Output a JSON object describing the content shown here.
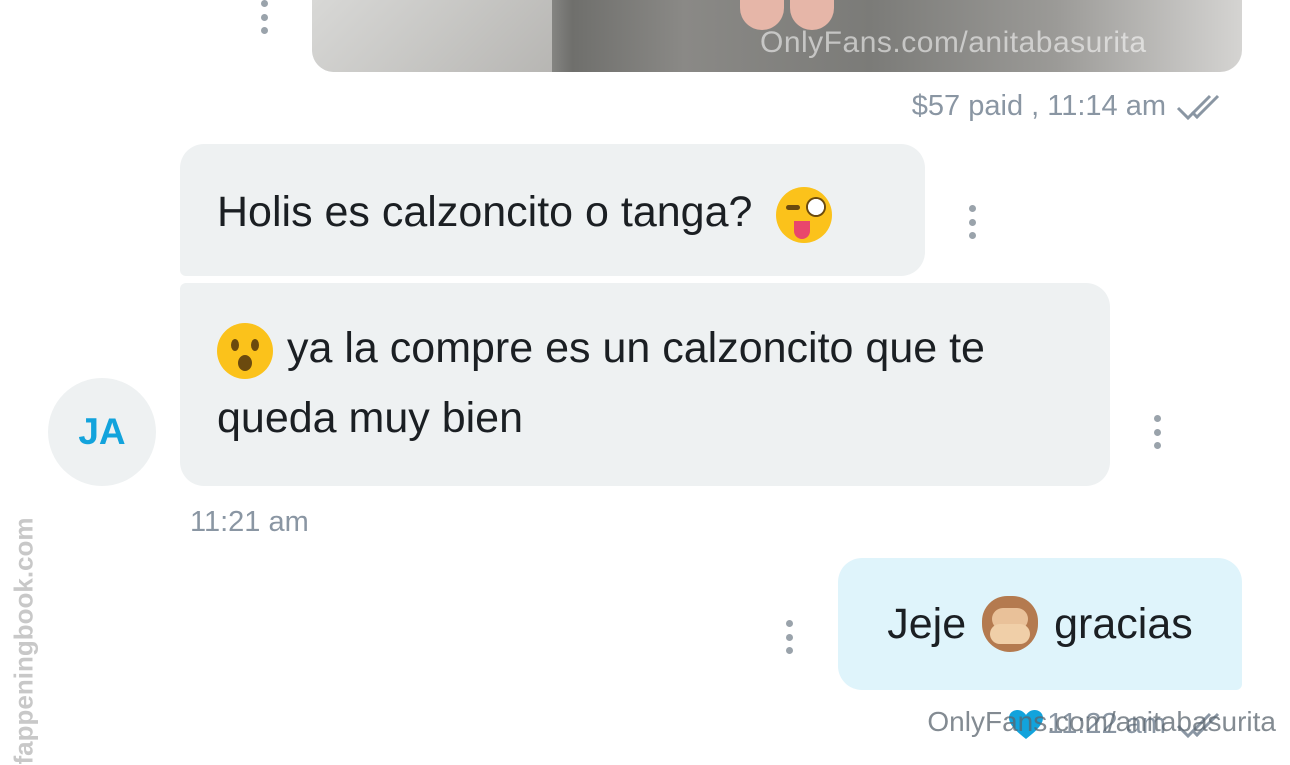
{
  "photo_message": {
    "watermark": "OnlyFans.com/anitabasurita",
    "status": "$57 paid , 11:14 am"
  },
  "incoming": {
    "avatar_initials": "JA",
    "message_1": "Holis es calzoncito o tanga?",
    "message_1_emoji": "winking-face-with-tongue",
    "message_2_emoji": "face-with-open-mouth",
    "message_2": "ya la compre es un calzoncito que te queda muy bien",
    "time": "11:21 am"
  },
  "outgoing": {
    "message_before_emoji": "Jeje",
    "emoji": "see-no-evil-monkey",
    "message_after_emoji": "gracias",
    "time": "11:22 am",
    "liked_icon": "heart-icon"
  },
  "overlay_watermarks": {
    "side": "fappeningbook.com",
    "bottom": "OnlyFans.com/anitabasurita"
  },
  "colors": {
    "incoming_bubble": "#eef1f2",
    "outgoing_bubble": "#dff4fb",
    "accent": "#12a3dc",
    "meta_text": "#8a96a3"
  }
}
